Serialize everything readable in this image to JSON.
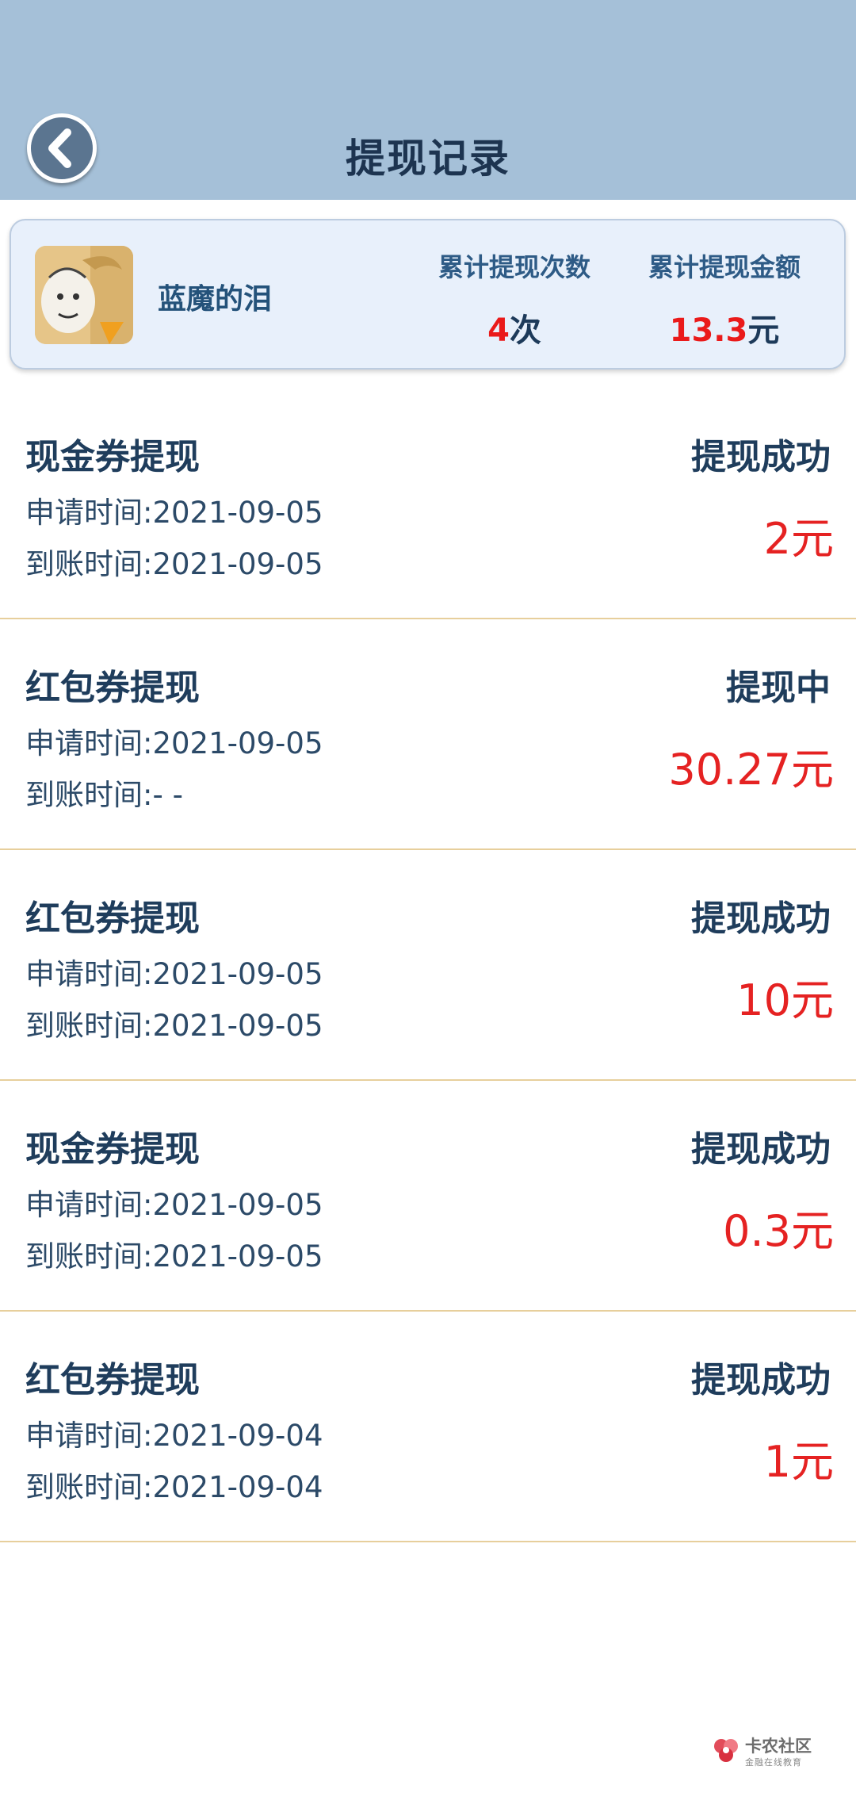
{
  "header": {
    "title": "提现记录"
  },
  "summary": {
    "username": "蓝魔的泪",
    "count_label": "累计提现次数",
    "count_value": "4",
    "count_unit": "次",
    "amount_label": "累计提现金额",
    "amount_value": "13.3",
    "amount_unit": "元"
  },
  "records": [
    {
      "title": "现金券提现",
      "status": "提现成功",
      "apply": "申请时间:2021-09-05",
      "arrive": "到账时间:2021-09-05",
      "amount": "2元"
    },
    {
      "title": "红包券提现",
      "status": "提现中",
      "apply": "申请时间:2021-09-05",
      "arrive": "到账时间:- -",
      "amount": "30.27元"
    },
    {
      "title": "红包券提现",
      "status": "提现成功",
      "apply": "申请时间:2021-09-05",
      "arrive": "到账时间:2021-09-05",
      "amount": "10元"
    },
    {
      "title": "现金券提现",
      "status": "提现成功",
      "apply": "申请时间:2021-09-05",
      "arrive": "到账时间:2021-09-05",
      "amount": "0.3元"
    },
    {
      "title": "红包券提现",
      "status": "提现成功",
      "apply": "申请时间:2021-09-04",
      "arrive": "到账时间:2021-09-04",
      "amount": "1元"
    }
  ],
  "watermark": {
    "title": "卡农社区",
    "subtitle": "金融在线教育"
  },
  "colors": {
    "header_bg": "#a5c0d8",
    "accent_red": "#e52222",
    "divider": "#e7cf9c"
  }
}
